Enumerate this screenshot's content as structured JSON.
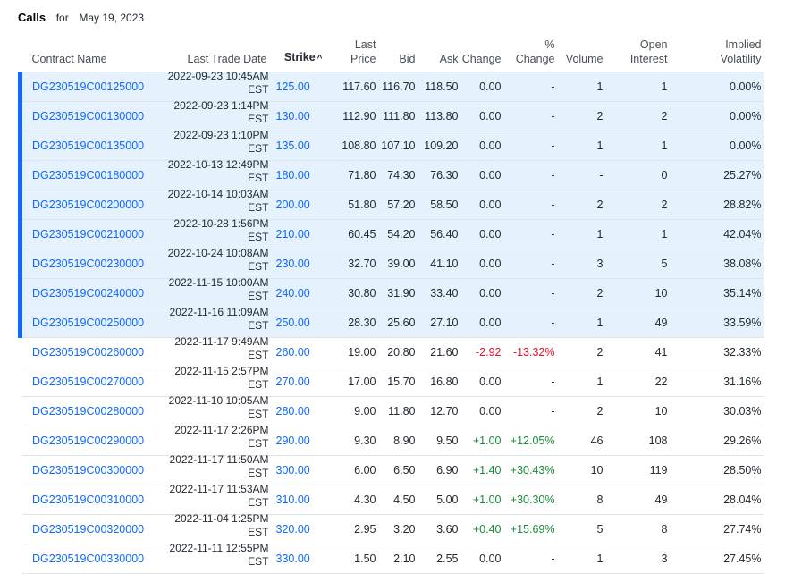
{
  "header": {
    "title": "Calls",
    "for_label": "for",
    "date": "May 19, 2023"
  },
  "columns": {
    "contract": "Contract Name",
    "last_trade_date": "Last Trade Date",
    "strike": "Strike",
    "strike_sort_icon": "caret-up-icon",
    "last_price_1": "Last",
    "last_price_2": "Price",
    "bid": "Bid",
    "ask": "Ask",
    "change": "Change",
    "pct_change_1": "%",
    "pct_change_2": "Change",
    "volume": "Volume",
    "open_interest_1": "Open",
    "open_interest_2": "Interest",
    "iv_1": "Implied",
    "iv_2": "Volatility"
  },
  "colors": {
    "itm_bg": "#e5f1fd",
    "itm_bar": "#0f69ff",
    "link": "#0f69ff",
    "positive": "#1a8a3b",
    "negative": "#eb0f29"
  },
  "rows": [
    {
      "contract": "DG230519C00125000",
      "date": "2022-09-23 10:45AM",
      "tz": "EST",
      "strike": "125.00",
      "last": "117.60",
      "bid": "116.70",
      "ask": "118.50",
      "change": "0.00",
      "pct": "-",
      "volume": "1",
      "oi": "1",
      "iv": "0.00%",
      "itm": true,
      "dir": "flat"
    },
    {
      "contract": "DG230519C00130000",
      "date": "2022-09-23 1:14PM",
      "tz": "EST",
      "strike": "130.00",
      "last": "112.90",
      "bid": "111.80",
      "ask": "113.80",
      "change": "0.00",
      "pct": "-",
      "volume": "2",
      "oi": "2",
      "iv": "0.00%",
      "itm": true,
      "dir": "flat"
    },
    {
      "contract": "DG230519C00135000",
      "date": "2022-09-23 1:10PM",
      "tz": "EST",
      "strike": "135.00",
      "last": "108.80",
      "bid": "107.10",
      "ask": "109.20",
      "change": "0.00",
      "pct": "-",
      "volume": "1",
      "oi": "1",
      "iv": "0.00%",
      "itm": true,
      "dir": "flat"
    },
    {
      "contract": "DG230519C00180000",
      "date": "2022-10-13 12:49PM",
      "tz": "EST",
      "strike": "180.00",
      "last": "71.80",
      "bid": "74.30",
      "ask": "76.30",
      "change": "0.00",
      "pct": "-",
      "volume": "-",
      "oi": "0",
      "iv": "25.27%",
      "itm": true,
      "dir": "flat"
    },
    {
      "contract": "DG230519C00200000",
      "date": "2022-10-14 10:03AM",
      "tz": "EST",
      "strike": "200.00",
      "last": "51.80",
      "bid": "57.20",
      "ask": "58.50",
      "change": "0.00",
      "pct": "-",
      "volume": "2",
      "oi": "2",
      "iv": "28.82%",
      "itm": true,
      "dir": "flat"
    },
    {
      "contract": "DG230519C00210000",
      "date": "2022-10-28 1:56PM",
      "tz": "EST",
      "strike": "210.00",
      "last": "60.45",
      "bid": "54.20",
      "ask": "56.40",
      "change": "0.00",
      "pct": "-",
      "volume": "1",
      "oi": "1",
      "iv": "42.04%",
      "itm": true,
      "dir": "flat"
    },
    {
      "contract": "DG230519C00230000",
      "date": "2022-10-24 10:08AM",
      "tz": "EST",
      "strike": "230.00",
      "last": "32.70",
      "bid": "39.00",
      "ask": "41.10",
      "change": "0.00",
      "pct": "-",
      "volume": "3",
      "oi": "5",
      "iv": "38.08%",
      "itm": true,
      "dir": "flat"
    },
    {
      "contract": "DG230519C00240000",
      "date": "2022-11-15 10:00AM",
      "tz": "EST",
      "strike": "240.00",
      "last": "30.80",
      "bid": "31.90",
      "ask": "33.40",
      "change": "0.00",
      "pct": "-",
      "volume": "2",
      "oi": "10",
      "iv": "35.14%",
      "itm": true,
      "dir": "flat"
    },
    {
      "contract": "DG230519C00250000",
      "date": "2022-11-16 11:09AM",
      "tz": "EST",
      "strike": "250.00",
      "last": "28.30",
      "bid": "25.60",
      "ask": "27.10",
      "change": "0.00",
      "pct": "-",
      "volume": "1",
      "oi": "49",
      "iv": "33.59%",
      "itm": true,
      "dir": "flat"
    },
    {
      "contract": "DG230519C00260000",
      "date": "2022-11-17 9:49AM",
      "tz": "EST",
      "strike": "260.00",
      "last": "19.00",
      "bid": "20.80",
      "ask": "21.60",
      "change": "-2.92",
      "pct": "-13.32%",
      "volume": "2",
      "oi": "41",
      "iv": "32.33%",
      "itm": false,
      "dir": "neg"
    },
    {
      "contract": "DG230519C00270000",
      "date": "2022-11-15 2:57PM",
      "tz": "EST",
      "strike": "270.00",
      "last": "17.00",
      "bid": "15.70",
      "ask": "16.80",
      "change": "0.00",
      "pct": "-",
      "volume": "1",
      "oi": "22",
      "iv": "31.16%",
      "itm": false,
      "dir": "flat"
    },
    {
      "contract": "DG230519C00280000",
      "date": "2022-11-10 10:05AM",
      "tz": "EST",
      "strike": "280.00",
      "last": "9.00",
      "bid": "11.80",
      "ask": "12.70",
      "change": "0.00",
      "pct": "-",
      "volume": "2",
      "oi": "10",
      "iv": "30.03%",
      "itm": false,
      "dir": "flat"
    },
    {
      "contract": "DG230519C00290000",
      "date": "2022-11-17 2:26PM",
      "tz": "EST",
      "strike": "290.00",
      "last": "9.30",
      "bid": "8.90",
      "ask": "9.50",
      "change": "+1.00",
      "pct": "+12.05%",
      "volume": "46",
      "oi": "108",
      "iv": "29.26%",
      "itm": false,
      "dir": "pos"
    },
    {
      "contract": "DG230519C00300000",
      "date": "2022-11-17 11:50AM",
      "tz": "EST",
      "strike": "300.00",
      "last": "6.00",
      "bid": "6.50",
      "ask": "6.90",
      "change": "+1.40",
      "pct": "+30.43%",
      "volume": "10",
      "oi": "119",
      "iv": "28.50%",
      "itm": false,
      "dir": "pos"
    },
    {
      "contract": "DG230519C00310000",
      "date": "2022-11-17 11:53AM",
      "tz": "EST",
      "strike": "310.00",
      "last": "4.30",
      "bid": "4.50",
      "ask": "5.00",
      "change": "+1.00",
      "pct": "+30.30%",
      "volume": "8",
      "oi": "49",
      "iv": "28.04%",
      "itm": false,
      "dir": "pos"
    },
    {
      "contract": "DG230519C00320000",
      "date": "2022-11-04 1:25PM",
      "tz": "EST",
      "strike": "320.00",
      "last": "2.95",
      "bid": "3.20",
      "ask": "3.60",
      "change": "+0.40",
      "pct": "+15.69%",
      "volume": "5",
      "oi": "8",
      "iv": "27.74%",
      "itm": false,
      "dir": "pos"
    },
    {
      "contract": "DG230519C00330000",
      "date": "2022-11-11 12:55PM",
      "tz": "EST",
      "strike": "330.00",
      "last": "1.50",
      "bid": "2.10",
      "ask": "2.55",
      "change": "0.00",
      "pct": "-",
      "volume": "1",
      "oi": "3",
      "iv": "27.45%",
      "itm": false,
      "dir": "flat"
    }
  ]
}
